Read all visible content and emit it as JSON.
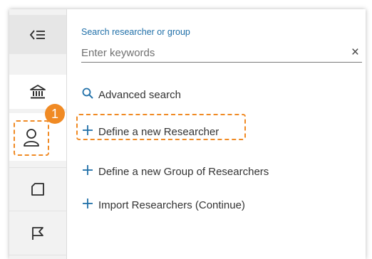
{
  "sidebar": {
    "items": [
      {
        "icon": "collapse-icon",
        "label": ""
      },
      {
        "icon": "institution-icon",
        "label": ""
      },
      {
        "icon": "person-icon",
        "label": ""
      },
      {
        "icon": "book-icon",
        "label": ""
      },
      {
        "icon": "flag-icon",
        "label": ""
      }
    ],
    "callout_number": "1"
  },
  "search": {
    "label": "Search researcher or group",
    "placeholder": "Enter keywords",
    "value": "",
    "clear_glyph": "×"
  },
  "actions": {
    "advanced_search": "Advanced search",
    "define_researcher": "Define a new Researcher",
    "define_group": "Define a new Group of Researchers",
    "import_researchers": "Import Researchers (Continue)"
  },
  "colors": {
    "accent": "#1f6fa8",
    "highlight": "#f08a24"
  }
}
